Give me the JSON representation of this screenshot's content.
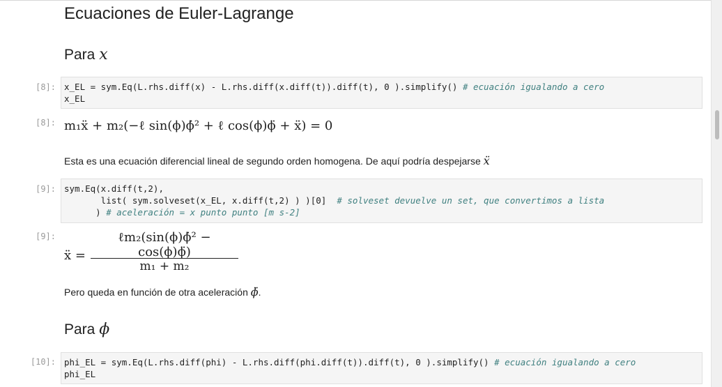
{
  "headings": {
    "main": "Ecuaciones de Euler-Lagrange",
    "para_x_word": "Para",
    "para_x_symbol": "x",
    "para_phi_word": "Para",
    "para_phi_symbol": "ϕ"
  },
  "cells": [
    {
      "in_prompt": "[8]:",
      "out_prompt": "[8]:",
      "code_line1": "x_EL = sym.Eq(L.rhs.diff(x) - L.rhs.diff(x.diff(t)).diff(t), 0 ).simplify() ",
      "code_line1_comment": "# ecuación igualando a cero",
      "code_line2": "x_EL"
    },
    {
      "in_prompt": "[9]:",
      "out_prompt": "[9]:",
      "code_line1": "sym.Eq(x.diff(t,2),",
      "code_line2": "       list( sym.solveset(x_EL, x.diff(t,2) ) )[0]  ",
      "code_line2_comment": "# solveset devuelve un set, que convertimos a lista",
      "code_line3": "      ) ",
      "code_line3_comment": "# aceleración = x punto punto [m s-2]"
    },
    {
      "in_prompt": "[10]:",
      "code_line1": "phi_EL = sym.Eq(L.rhs.diff(phi) - L.rhs.diff(phi.diff(t)).diff(t), 0 ).simplify() ",
      "code_line1_comment": "# ecuación igualando a cero",
      "code_line2": "phi_EL"
    }
  ],
  "outputs": {
    "eq8": "m₁ẍ + m₂(−ℓ sin(ϕ)ϕ̇² + ℓ cos(ϕ)ϕ̈ + ẍ) = 0",
    "eq9_lhs": "ẍ =",
    "eq9_numerator": "ℓm₂(sin(ϕ)ϕ̇² − cos(ϕ)ϕ̈)",
    "eq9_denominator": "m₁ + m₂"
  },
  "texts": {
    "para1": "Esta es una ecuación diferencial lineal de segundo orden homogena. De aquí podría despejarse ",
    "para1_symbol": "ẍ",
    "para2": "Pero queda en función de otra aceleración ",
    "para2_symbol": "ϕ̈",
    "para2_end": "."
  }
}
